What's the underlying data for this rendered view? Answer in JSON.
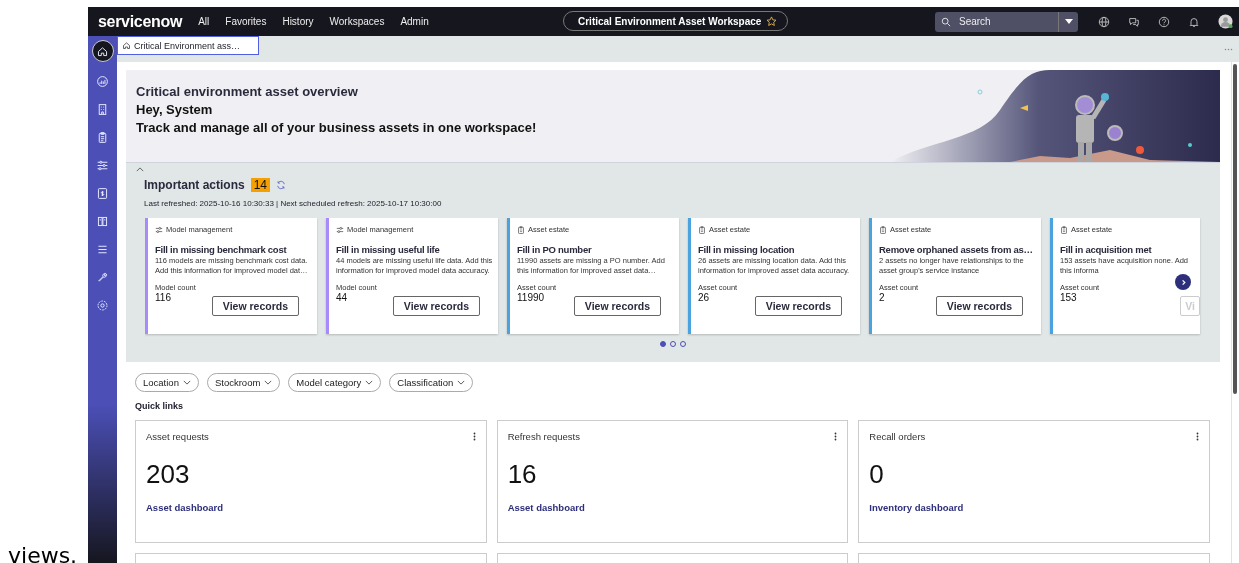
{
  "caption_fragment": "views.",
  "top_nav": {
    "logo": "servicenow",
    "menu": [
      "All",
      "Favorites",
      "History",
      "Workspaces",
      "Admin"
    ],
    "workspace_title": "Critical Environment Asset Workspace",
    "search": {
      "placeholder": "Search"
    }
  },
  "sidebar": {
    "items": [
      {
        "selected": true
      },
      {
        "selected": false
      },
      {
        "selected": false
      },
      {
        "selected": false
      },
      {
        "selected": false
      },
      {
        "selected": false
      },
      {
        "selected": false
      },
      {
        "selected": false
      },
      {
        "selected": false
      },
      {
        "selected": false
      }
    ]
  },
  "tabs": [
    {
      "label": "Critical Environment ass…",
      "selected": true
    }
  ],
  "banner": {
    "title": "Critical environment asset overview",
    "greeting": "Hey, System",
    "tagline": "Track and manage all of your business assets in one workspace!"
  },
  "important_actions": {
    "title": "Important actions",
    "count": "14",
    "refresh_info": "Last refreshed: 2025-10-16 10:30:33 | Next scheduled refresh: 2025-10-17 10:30:00",
    "cards": [
      {
        "category": "Model management",
        "kind": "model",
        "color": "#a78bfa",
        "title": "Fill in missing benchmark cost",
        "description": "116 models are missing benchmark cost data. Add this information for improved model dat…",
        "count_label": "Model count",
        "count": "116",
        "button": "View records"
      },
      {
        "category": "Model management",
        "kind": "model",
        "color": "#a78bfa",
        "title": "Fill in missing useful life",
        "description": "44 models are missing useful life data. Add this information for improved model data accuracy.",
        "count_label": "Model count",
        "count": "44",
        "button": "View records"
      },
      {
        "category": "Asset estate",
        "kind": "asset",
        "color": "#4aa3df",
        "title": "Fill in PO number",
        "description": "11990 assets are missing a PO number. Add this information for improved asset data…",
        "count_label": "Asset count",
        "count": "11990",
        "button": "View records"
      },
      {
        "category": "Asset estate",
        "kind": "asset",
        "color": "#4aa3df",
        "title": "Fill in missing location",
        "description": "26 assets are missing location data. Add this information for improved asset data accuracy.",
        "count_label": "Asset count",
        "count": "26",
        "button": "View records"
      },
      {
        "category": "Asset estate",
        "kind": "asset",
        "color": "#4aa3df",
        "title": "Remove orphaned assets from as…",
        "description": "2 assets no longer have relationships to the asset group's service instance",
        "count_label": "Asset count",
        "count": "2",
        "button": "View records"
      },
      {
        "category": "Asset estate",
        "kind": "asset",
        "color": "#4aa3df",
        "title": "Fill in acquisition met",
        "description": "153 assets have acquisition none. Add this informa",
        "count_label": "Asset count",
        "count": "153",
        "button": "Vi"
      }
    ],
    "pages": [
      {
        "selected": true
      },
      {
        "selected": false
      },
      {
        "selected": false
      }
    ]
  },
  "filters": [
    "Location",
    "Stockroom",
    "Model category",
    "Classification"
  ],
  "quick_links": {
    "title": "Quick links",
    "widgets": [
      {
        "title": "Asset requests",
        "value": "203",
        "link": "Asset dashboard"
      },
      {
        "title": "Refresh requests",
        "value": "16",
        "link": "Asset dashboard"
      },
      {
        "title": "Recall orders",
        "value": "0",
        "link": "Inventory dashboard"
      }
    ]
  }
}
